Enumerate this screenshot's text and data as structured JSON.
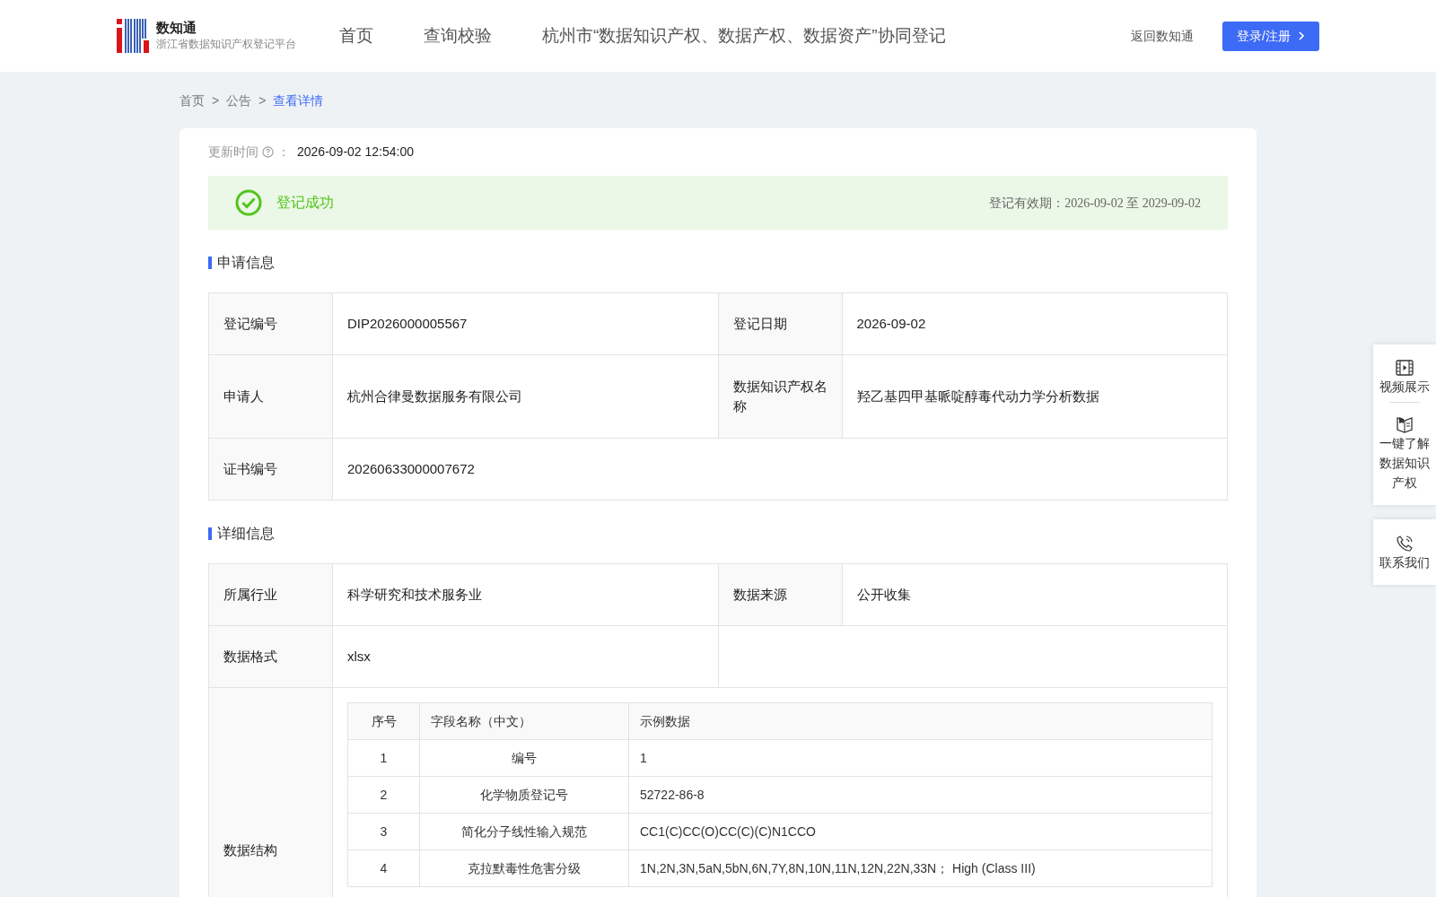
{
  "header": {
    "brand": "数知通",
    "subtitle": "浙江省数据知识产权登记平台",
    "nav": [
      {
        "label": "首页",
        "selected": false
      },
      {
        "label": "查询校验",
        "selected": false
      },
      {
        "label": "杭州市“数据知识产权、数据产权、数据资产”协同登记",
        "selected": false
      }
    ],
    "back_link": "返回数知通",
    "login_button": "登录/注册"
  },
  "breadcrumb": [
    {
      "label": "首页",
      "selected": false
    },
    {
      "label": "公告",
      "selected": false
    },
    {
      "label": "查看详情",
      "selected": true
    }
  ],
  "breadcrumb_separator": ">",
  "update": {
    "label": "更新时间",
    "colon": "：",
    "value": "2026-09-02 12:54:00"
  },
  "status": {
    "text": "登记成功",
    "validity": "登记有效期：2026-09-02 至 2029-09-02"
  },
  "application": {
    "title": "申请信息",
    "rows": [
      [
        {
          "label": "登记编号",
          "value": "DIP2026000005567"
        },
        {
          "label": "登记日期",
          "value": "2026-09-02"
        }
      ],
      [
        {
          "label": "申请人",
          "value": "杭州合律曼数据服务有限公司"
        },
        {
          "label": "数据知识产权名称",
          "value": "羟乙基四甲基哌啶醇毒代动力学分析数据"
        }
      ],
      [
        {
          "label": "证书编号",
          "value": "20260633000007672"
        }
      ]
    ]
  },
  "details": {
    "title": "详细信息",
    "rows": [
      [
        {
          "label": "所属行业",
          "value": "科学研究和技术服务业"
        },
        {
          "label": "数据来源",
          "value": "公开收集"
        }
      ],
      [
        {
          "label": "数据格式",
          "value": "xlsx"
        }
      ]
    ],
    "structure": {
      "label": "数据结构",
      "columns": [
        "序号",
        "字段名称（中文）",
        "示例数据"
      ],
      "rows": [
        [
          "1",
          "编号",
          "1"
        ],
        [
          "2",
          "化学物质登记号",
          "52722-86-8"
        ],
        [
          "3",
          "简化分子线性输入规范",
          "CC1(C)CC(O)CC(C)(C)N1CCO"
        ],
        [
          "4",
          "克拉默毒性危害分级",
          "1N,2N,3N,5aN,5bN,6N,7Y,8N,10N,11N,12N,22N,33N； High (Class III)"
        ]
      ]
    }
  },
  "side_panel": [
    {
      "kind": "video",
      "label": "视频展示"
    },
    {
      "kind": "book",
      "label": "一键了解数据知识产权"
    },
    {
      "kind": "phone",
      "label": "联系我们"
    }
  ]
}
